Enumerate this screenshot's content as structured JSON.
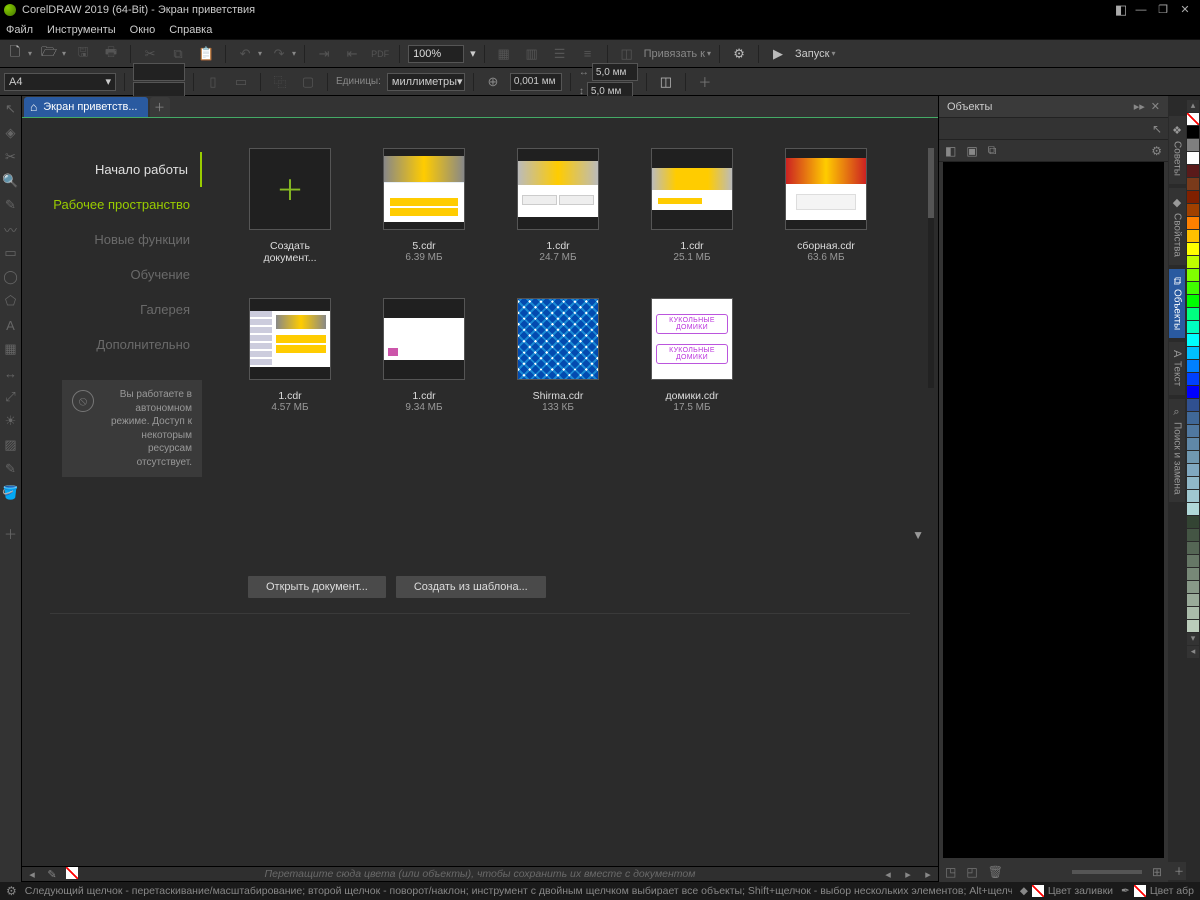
{
  "title": "CorelDRAW 2019 (64-Bit) - Экран приветствия",
  "menu": [
    "Файл",
    "Инструменты",
    "Окно",
    "Справка"
  ],
  "toolbar": {
    "zoom": "100%",
    "snap": "Привязать к",
    "launch": "Запуск"
  },
  "toolbar2": {
    "pagesize": "A4",
    "unitslabel": "Единицы:",
    "units": "миллиметры",
    "nudge": "0,001 мм",
    "dup1": "5,0 мм",
    "dup2": "5,0 мм"
  },
  "tab": {
    "label": "Экран приветств..."
  },
  "sidebar": {
    "items": [
      "Начало работы",
      "Рабочее пространство",
      "Новые функции",
      "Обучение",
      "Галерея",
      "Дополнительно"
    ],
    "offline": "Вы работаете в автономном режиме. Доступ к некоторым ресурсам отсутствует."
  },
  "gallery": {
    "newdoc": "Создать документ...",
    "files": [
      {
        "name": "5.cdr",
        "size": "6.39 МБ"
      },
      {
        "name": "1.cdr",
        "size": "24.7 МБ"
      },
      {
        "name": "1.cdr",
        "size": "25.1 МБ"
      },
      {
        "name": "сборная.cdr",
        "size": "63.6 МБ"
      },
      {
        "name": "1.cdr",
        "size": "4.57 МБ"
      },
      {
        "name": "1.cdr",
        "size": "9.34 МБ"
      },
      {
        "name": "Shirma.cdr",
        "size": "133 КБ"
      },
      {
        "name": "домики.cdr",
        "size": "17.5 МБ"
      }
    ],
    "open": "Открыть документ...",
    "template": "Создать из шаблона..."
  },
  "rightpanel": {
    "title": "Объекты"
  },
  "rightdock": [
    "Советы",
    "Свойства",
    "Объекты",
    "Текст",
    "Поиск и замена"
  ],
  "palette": [
    "#000000",
    "#7f7f7f",
    "#ffffff",
    "#5a1a1a",
    "#7a3a1a",
    "#802000",
    "#a04000",
    "#ff8000",
    "#ffbf00",
    "#ffff00",
    "#bfff00",
    "#80ff00",
    "#40ff00",
    "#00ff00",
    "#00ff80",
    "#00ffbf",
    "#00ffff",
    "#00bfff",
    "#0080ff",
    "#0040ff",
    "#0000ff",
    "#305090",
    "#406898",
    "#5078a0",
    "#6088a8",
    "#7098b0",
    "#80a8c0",
    "#90b8c8",
    "#a0c8d0",
    "#b0d8d8",
    "#334433",
    "#445544",
    "#556655",
    "#667766",
    "#778877",
    "#889988",
    "#99aa99",
    "#aabbaa",
    "#bbccbb"
  ],
  "bottom": {
    "hint": "Перетащите сюда цвета (или объекты), чтобы сохранить их вместе с документом",
    "status": "Следующий щелчок - перетаскивание/масштабирование; второй щелчок - поворот/наклон; инструмент с двойным щелчком выбирает все объекты; Shift+щелчок - выбор нескольких элементов; Alt+щелчок - цифры",
    "fill": "Цвет заливки",
    "outline": "Цвет абр"
  }
}
